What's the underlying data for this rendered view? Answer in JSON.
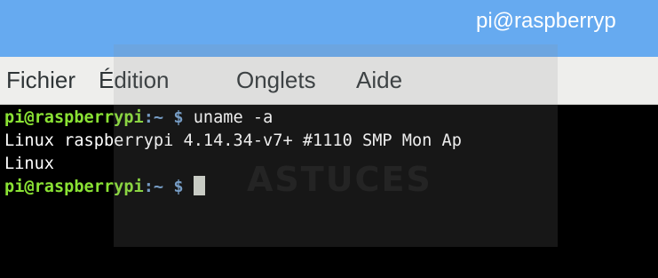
{
  "window": {
    "title": "pi@raspberryp"
  },
  "menu": {
    "items": [
      "Fichier",
      "Édition",
      "Onglets",
      "Aide"
    ]
  },
  "terminal": {
    "prompt_user": "pi@raspberrypi",
    "prompt_path": ":~ $",
    "lines": {
      "command": " uname -a",
      "output1": "Linux raspberrypi 4.14.34-v7+ #1110 SMP Mon Ap",
      "output2": "Linux"
    }
  },
  "watermark": {
    "text": "ASTUCES"
  },
  "colors": {
    "titlebar": "#66aaf0",
    "menubar": "#eeeeec",
    "terminal_bg": "#000000",
    "prompt_user": "#8ae234",
    "prompt_path": "#729fcf",
    "text": "#ffffff"
  }
}
